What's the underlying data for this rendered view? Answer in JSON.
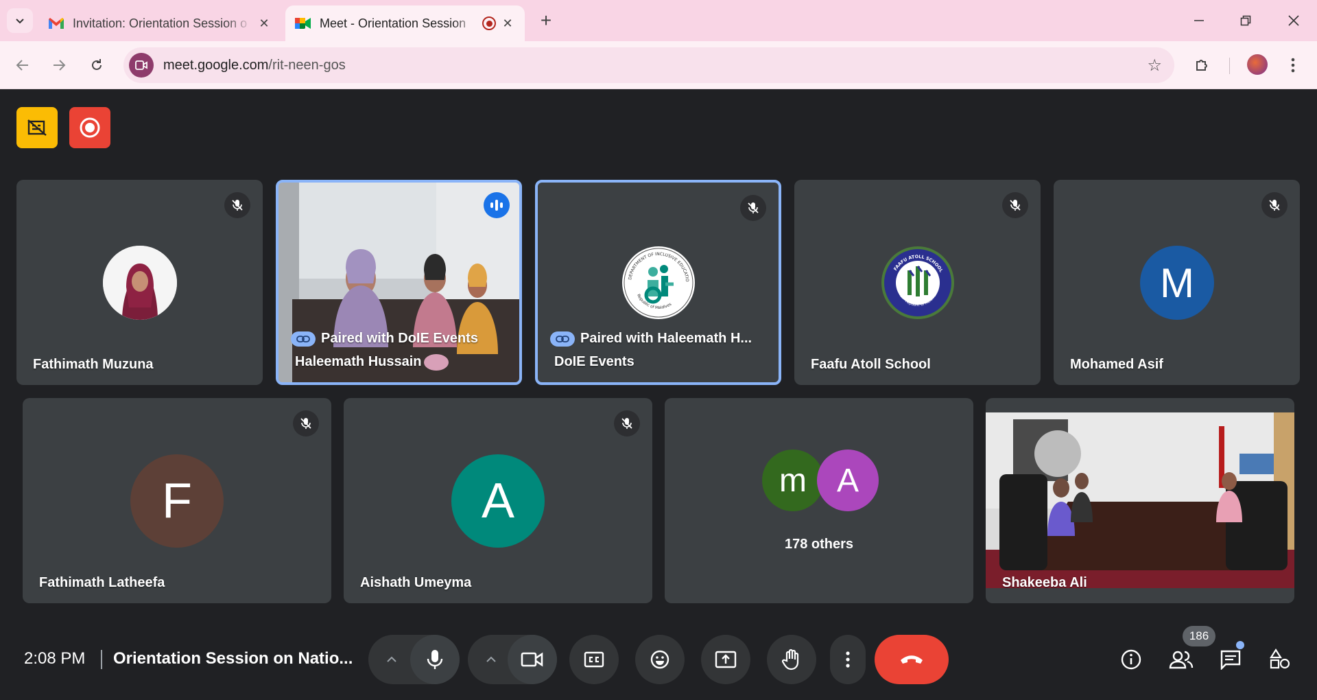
{
  "browser": {
    "tabs": [
      {
        "title": "Invitation: Orientation Session o",
        "active": false,
        "icon": "gmail-icon"
      },
      {
        "title": "Meet - Orientation Session",
        "active": true,
        "icon": "meet-icon",
        "recording": true
      }
    ],
    "url_host": "meet.google.com",
    "url_path": "/rit-neen-gos"
  },
  "meet": {
    "tiles": [
      {
        "name": "Fathimath Muzuna",
        "muted": true,
        "avatar": "photo"
      },
      {
        "name": "Haleemath Hussain",
        "paired": "Paired with DoIE Events",
        "speaking": true,
        "video": true
      },
      {
        "name": "DoIE Events",
        "paired": "Paired with Haleemath H...",
        "muted": true,
        "avatar": "logo"
      },
      {
        "name": "Faafu Atoll School",
        "muted": true,
        "avatar": "logo"
      },
      {
        "name": "Mohamed Asif",
        "muted": true,
        "avatar_letter": "M",
        "avatar_color": "#1a5aa3"
      },
      {
        "name": "Fathimath Latheefa",
        "muted": true,
        "avatar_letter": "F",
        "avatar_color": "#5d4037"
      },
      {
        "name": "Aishath Umeyma",
        "muted": true,
        "avatar_letter": "A",
        "avatar_color": "#00897b"
      },
      {
        "name": "178 others",
        "avatars": [
          {
            "letter": "m",
            "color": "#33691e"
          },
          {
            "letter": "A",
            "color": "#ab47bc"
          }
        ]
      },
      {
        "name": "Shakeeba Ali",
        "video": true
      }
    ],
    "logo_texts": {
      "doie_top": "DEPARTMENT OF INCLUSIVE EDUCATION",
      "doie_bottom": "Republic of Maldives",
      "faafu_top": "FAAFU ATOLL SCHOOL",
      "faafu_bottom": "Feeali · Republic of Maldives"
    },
    "clock": "2:08 PM",
    "meeting_title": "Orientation Session on Natio...",
    "participant_count": "186",
    "colors": {
      "background": "#202124",
      "tile": "#3c4043",
      "end_call": "#ea4335",
      "accent": "#8ab4f8"
    }
  }
}
